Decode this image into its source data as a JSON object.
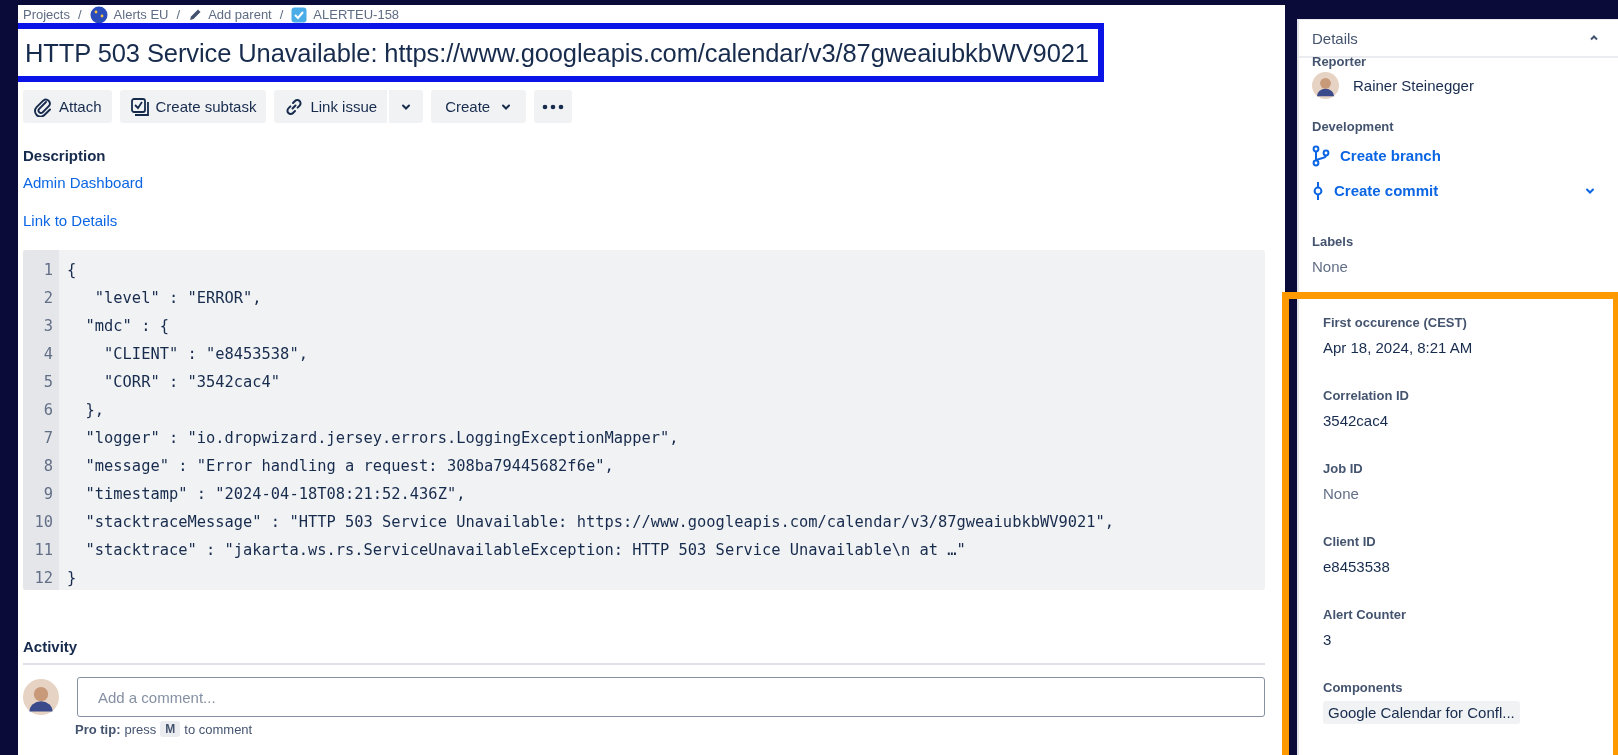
{
  "breadcrumb": [
    {
      "kind": "project",
      "label": "Projects"
    },
    {
      "kind": "separator",
      "label": "/"
    },
    {
      "kind": "space",
      "label": "Alerts EU"
    },
    {
      "kind": "separator",
      "label": "/"
    },
    {
      "kind": "parent",
      "label": "Add parent"
    },
    {
      "kind": "separator",
      "label": "/"
    },
    {
      "kind": "issue",
      "label": "ALERTEU-158"
    }
  ],
  "title": "HTTP 503 Service Unavailable: https://www.googleapis.com/calendar/v3/87gweaiubkbWV9021",
  "toolbar": [
    {
      "kind": "attach",
      "label": "Attach"
    },
    {
      "kind": "subtask",
      "label": "Create subtask"
    },
    {
      "kind": "link",
      "label": "Link issue"
    },
    {
      "kind": "split"
    },
    {
      "kind": "dropdown",
      "label": "Create"
    },
    {
      "kind": "more"
    }
  ],
  "description": {
    "heading": "Description",
    "links": [
      "Admin Dashboard",
      "Link to Details"
    ]
  },
  "code": [
    {
      "n": "1",
      "text": "{"
    },
    {
      "n": "2",
      "text": "   \"level\" : \"ERROR\","
    },
    {
      "n": "3",
      "text": "  \"mdc\" : {"
    },
    {
      "n": "4",
      "text": "    \"CLIENT\" : \"e8453538\","
    },
    {
      "n": "5",
      "text": "    \"CORR\" : \"3542cac4\""
    },
    {
      "n": "6",
      "text": "  },"
    },
    {
      "n": "7",
      "text": "  \"logger\" : \"io.dropwizard.jersey.errors.LoggingExceptionMapper\","
    },
    {
      "n": "8",
      "text": "  \"message\" : \"Error handling a request: 308ba79445682f6e\","
    },
    {
      "n": "9",
      "text": "  \"timestamp\" : \"2024-04-18T08:21:52.436Z\","
    },
    {
      "n": "10",
      "text": "  \"stacktraceMessage\" : \"HTTP 503 Service Unavailable: https://www.googleapis.com/calendar/v3/87gweaiubkbWV9021\","
    },
    {
      "n": "11",
      "text": "  \"stacktrace\" : \"jakarta.ws.rs.ServiceUnavailableException: HTTP 503 Service Unavailable\\n at …\""
    },
    {
      "n": "12",
      "text": "}"
    }
  ],
  "activity": {
    "heading": "Activity",
    "placeholder": "Add a comment...",
    "tip_label": "Pro tip:",
    "tip_before": "press",
    "tip_key": "M",
    "tip_after": "to comment"
  },
  "sidebar": {
    "header": "Details",
    "expanded": true,
    "reporter": {
      "label": "Reporter",
      "name": "Rainer Steinegger"
    },
    "development": {
      "label": "Development",
      "links": [
        {
          "kind": "branch",
          "label": "Create branch",
          "has_menu": false
        },
        {
          "kind": "commit",
          "label": "Create commit",
          "has_menu": true
        }
      ]
    },
    "labels": {
      "label": "Labels",
      "value": "None",
      "empty": true
    },
    "fields": [
      {
        "label": "First occurence (CEST)",
        "value": "Apr 18, 2024, 8:21 AM",
        "empty": false
      },
      {
        "label": "Correlation ID",
        "value": "3542cac4",
        "empty": false
      },
      {
        "label": "Job ID",
        "value": "None",
        "empty": true
      },
      {
        "label": "Client ID",
        "value": "e8453538",
        "empty": false
      },
      {
        "label": "Alert Counter",
        "value": "3",
        "empty": false
      }
    ],
    "components": {
      "label": "Components",
      "chips": [
        "Google Calendar for Confl..."
      ]
    }
  }
}
